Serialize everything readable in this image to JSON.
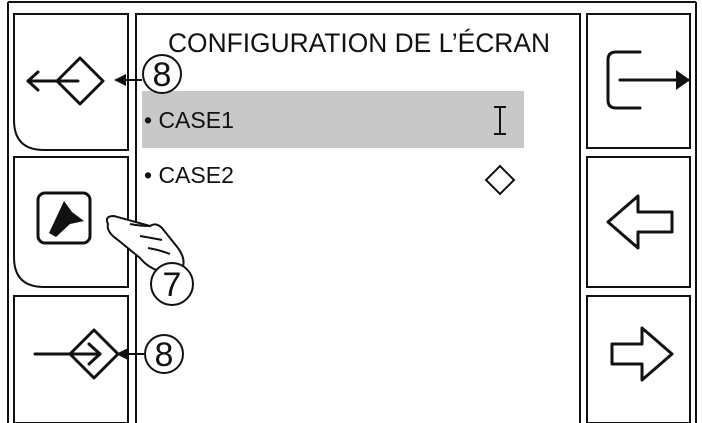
{
  "screen": {
    "title": "CONFIGURATION DE L’ÉCRAN",
    "items": [
      {
        "label": "• CASE1",
        "selected": true,
        "indicator": "text-cursor-icon"
      },
      {
        "label": "• CASE2",
        "selected": false,
        "indicator": "diamond-icon"
      }
    ]
  },
  "left_buttons": [
    {
      "icon": "move-left-icon"
    },
    {
      "icon": "tool-icon"
    },
    {
      "icon": "enter-down-icon"
    }
  ],
  "right_buttons": [
    {
      "icon": "exit-icon"
    },
    {
      "icon": "arrow-left-icon"
    },
    {
      "icon": "arrow-right-icon"
    }
  ],
  "callouts": {
    "top": "8",
    "middle": "7",
    "bottom": "8"
  },
  "colors": {
    "selection_highlight": "#c8c8c8",
    "line": "#111111"
  }
}
